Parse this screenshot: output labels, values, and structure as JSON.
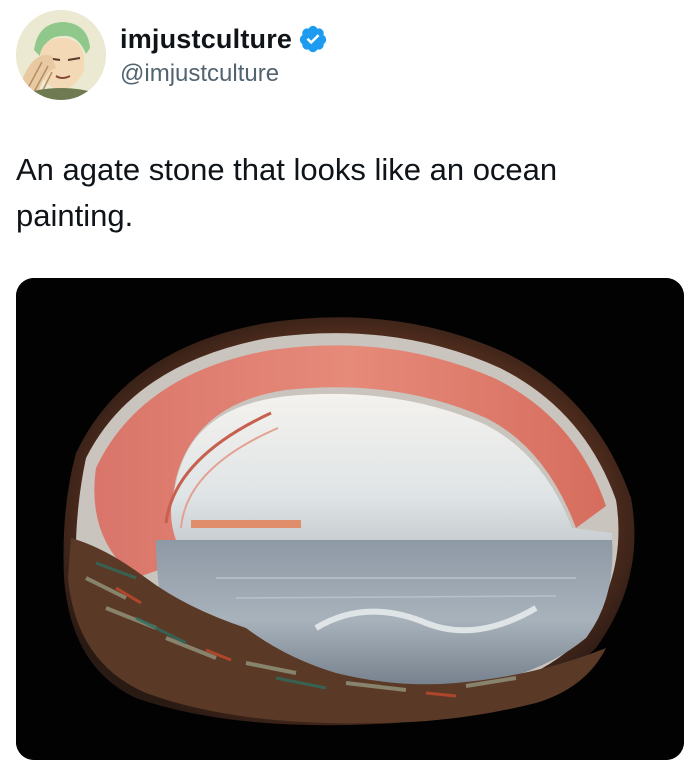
{
  "author": {
    "display_name": "imjustculture",
    "handle": "@imjustculture",
    "verified_icon": "verified-badge-icon",
    "avatar": "anime-character-avatar",
    "accent_color": "#1d9bf0"
  },
  "tweet": {
    "text": "An agate stone that looks like an ocean painting."
  },
  "media": {
    "description_icon": "agate-stone-photo"
  }
}
